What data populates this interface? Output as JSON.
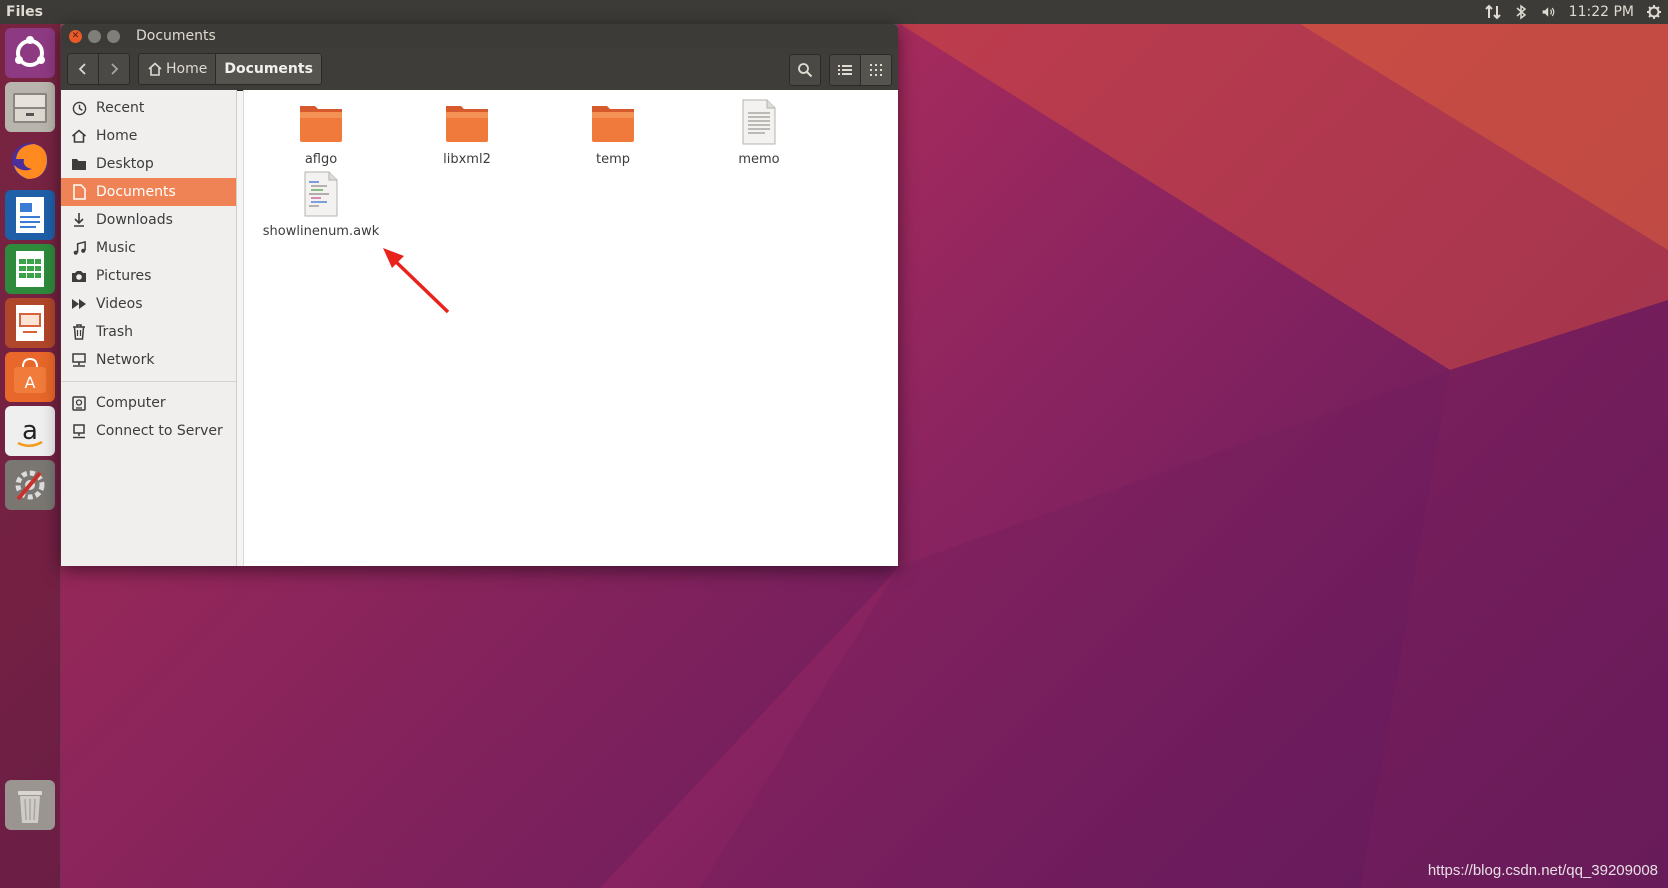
{
  "top_panel": {
    "app_title": "Files",
    "clock": "11:22 PM",
    "indicators": [
      "network-icon",
      "bluetooth-icon",
      "volume-icon",
      "power-gear-icon"
    ]
  },
  "launcher": {
    "items": [
      "ubuntu-dash-icon",
      "files-icon",
      "firefox-icon",
      "writer-icon",
      "calc-icon",
      "impress-icon",
      "software-center-icon",
      "amazon-icon",
      "system-settings-icon",
      "trash-icon"
    ]
  },
  "window": {
    "title": "Documents",
    "path": {
      "home": "Home",
      "current": "Documents"
    },
    "sidebar": {
      "places": [
        {
          "label": "Recent",
          "icon": "clock-icon"
        },
        {
          "label": "Home",
          "icon": "home-icon"
        },
        {
          "label": "Desktop",
          "icon": "desktop-folder-icon"
        },
        {
          "label": "Documents",
          "icon": "document-icon",
          "selected": true
        },
        {
          "label": "Downloads",
          "icon": "download-icon"
        },
        {
          "label": "Music",
          "icon": "music-icon"
        },
        {
          "label": "Pictures",
          "icon": "camera-icon"
        },
        {
          "label": "Videos",
          "icon": "video-icon"
        },
        {
          "label": "Trash",
          "icon": "trash-icon"
        },
        {
          "label": "Network",
          "icon": "network-icon"
        }
      ],
      "devices": [
        {
          "label": "Computer",
          "icon": "drive-icon"
        },
        {
          "label": "Connect to Server",
          "icon": "server-icon"
        }
      ]
    },
    "files": [
      {
        "name": "aflgo",
        "type": "folder"
      },
      {
        "name": "libxml2",
        "type": "folder"
      },
      {
        "name": "temp",
        "type": "folder"
      },
      {
        "name": "memo",
        "type": "text"
      },
      {
        "name": "showlinenum.awk",
        "type": "script"
      }
    ]
  },
  "watermark": "https://blog.csdn.net/qq_39209008",
  "colors": {
    "accent": "#f08355",
    "panel": "#3c3b37",
    "close": "#e9592a",
    "arrow": "#e8231c"
  }
}
